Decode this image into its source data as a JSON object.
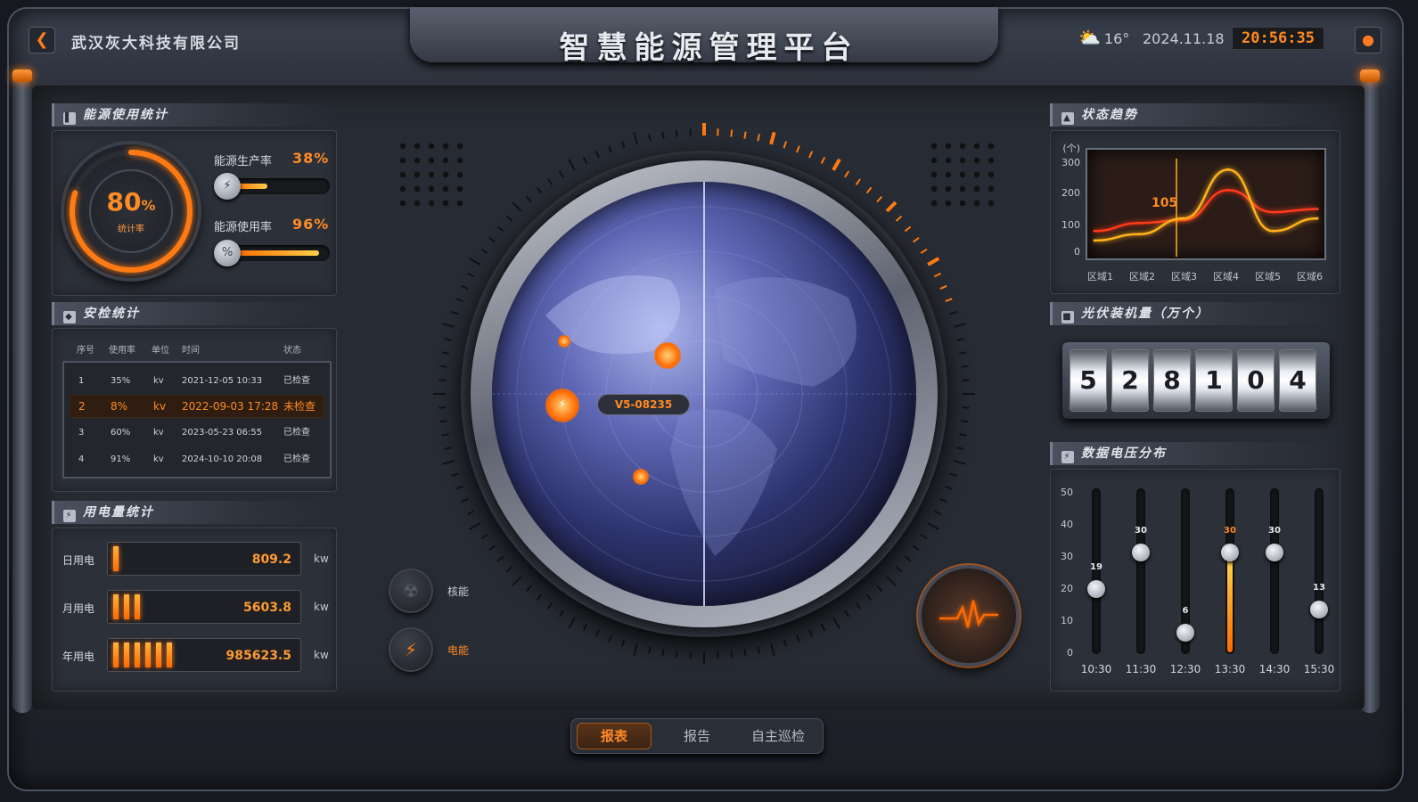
{
  "header": {
    "company": "武汉灰大科技有限公司",
    "title": "智慧能源管理平台",
    "weather_temp": "16°",
    "date": "2024.11.18",
    "time": "20:56:35"
  },
  "energy_stats": {
    "heading": "能源使用统计",
    "gauge_value": "80",
    "gauge_unit": "%",
    "gauge_label": "统计率",
    "gauge_fraction": 0.8,
    "rates": [
      {
        "label": "能源生产率",
        "value": "38%",
        "fraction": 0.38
      },
      {
        "label": "能源使用率",
        "value": "96%",
        "fraction": 0.96
      }
    ]
  },
  "security": {
    "heading": "安检统计",
    "columns": [
      "序号",
      "使用率",
      "单位",
      "时间",
      "状态"
    ],
    "rows": [
      {
        "no": "1",
        "rate": "35%",
        "unit": "kv",
        "time": "2021-12-05 10:33",
        "status": "已检查"
      },
      {
        "no": "2",
        "rate": "8%",
        "unit": "kv",
        "time": "2022-09-03 17:28",
        "status": "未检查"
      },
      {
        "no": "3",
        "rate": "60%",
        "unit": "kv",
        "time": "2023-05-23 06:55",
        "status": "已检查"
      },
      {
        "no": "4",
        "rate": "91%",
        "unit": "kv",
        "time": "2024-10-10 20:08",
        "status": "已检查"
      }
    ]
  },
  "usage": {
    "heading": "用电量统计",
    "items": [
      {
        "label": "日用电",
        "value": "809.2",
        "unit": "kw",
        "segments": 1
      },
      {
        "label": "月用电",
        "value": "5603.8",
        "unit": "kw",
        "segments": 3
      },
      {
        "label": "年用电",
        "value": "985623.5",
        "unit": "kw",
        "segments": 6
      }
    ]
  },
  "center": {
    "radar_label": "V5-08235",
    "buttons": [
      {
        "label": "核能",
        "icon": "radiation-icon"
      },
      {
        "label": "电能",
        "icon": "bolt-icon"
      }
    ]
  },
  "trend": {
    "heading": "状态趋势",
    "highlight_value": "105",
    "chart_data": {
      "type": "line",
      "ylabel": "(个)",
      "ylim": [
        0,
        300
      ],
      "yticks": [
        "300",
        "200",
        "100",
        "0"
      ],
      "categories": [
        "区域1",
        "区域2",
        "区域3",
        "区域4",
        "区域5",
        "区域6"
      ],
      "series": [
        {
          "values": [
            70,
            95,
            105,
            200,
            130,
            140
          ],
          "color": "#ff3a1a"
        },
        {
          "values": [
            40,
            60,
            110,
            265,
            70,
            110
          ],
          "color": "#ffb21a"
        }
      ]
    }
  },
  "pv": {
    "heading": "光伏装机量（万个）",
    "digits": [
      "5",
      "2",
      "8",
      "1",
      "0",
      "4"
    ]
  },
  "voltage": {
    "heading": "数据电压分布",
    "chart_data": {
      "type": "bar",
      "ylim": [
        0,
        50
      ],
      "yticks": [
        "50",
        "40",
        "30",
        "20",
        "10",
        "0"
      ],
      "categories": [
        "10:30",
        "11:30",
        "12:30",
        "13:30",
        "14:30",
        "15:30"
      ],
      "values": [
        19,
        30,
        6,
        30,
        30,
        13
      ],
      "highlight_index": 3
    }
  },
  "tabs": [
    "报表",
    "报告",
    "自主巡检"
  ]
}
